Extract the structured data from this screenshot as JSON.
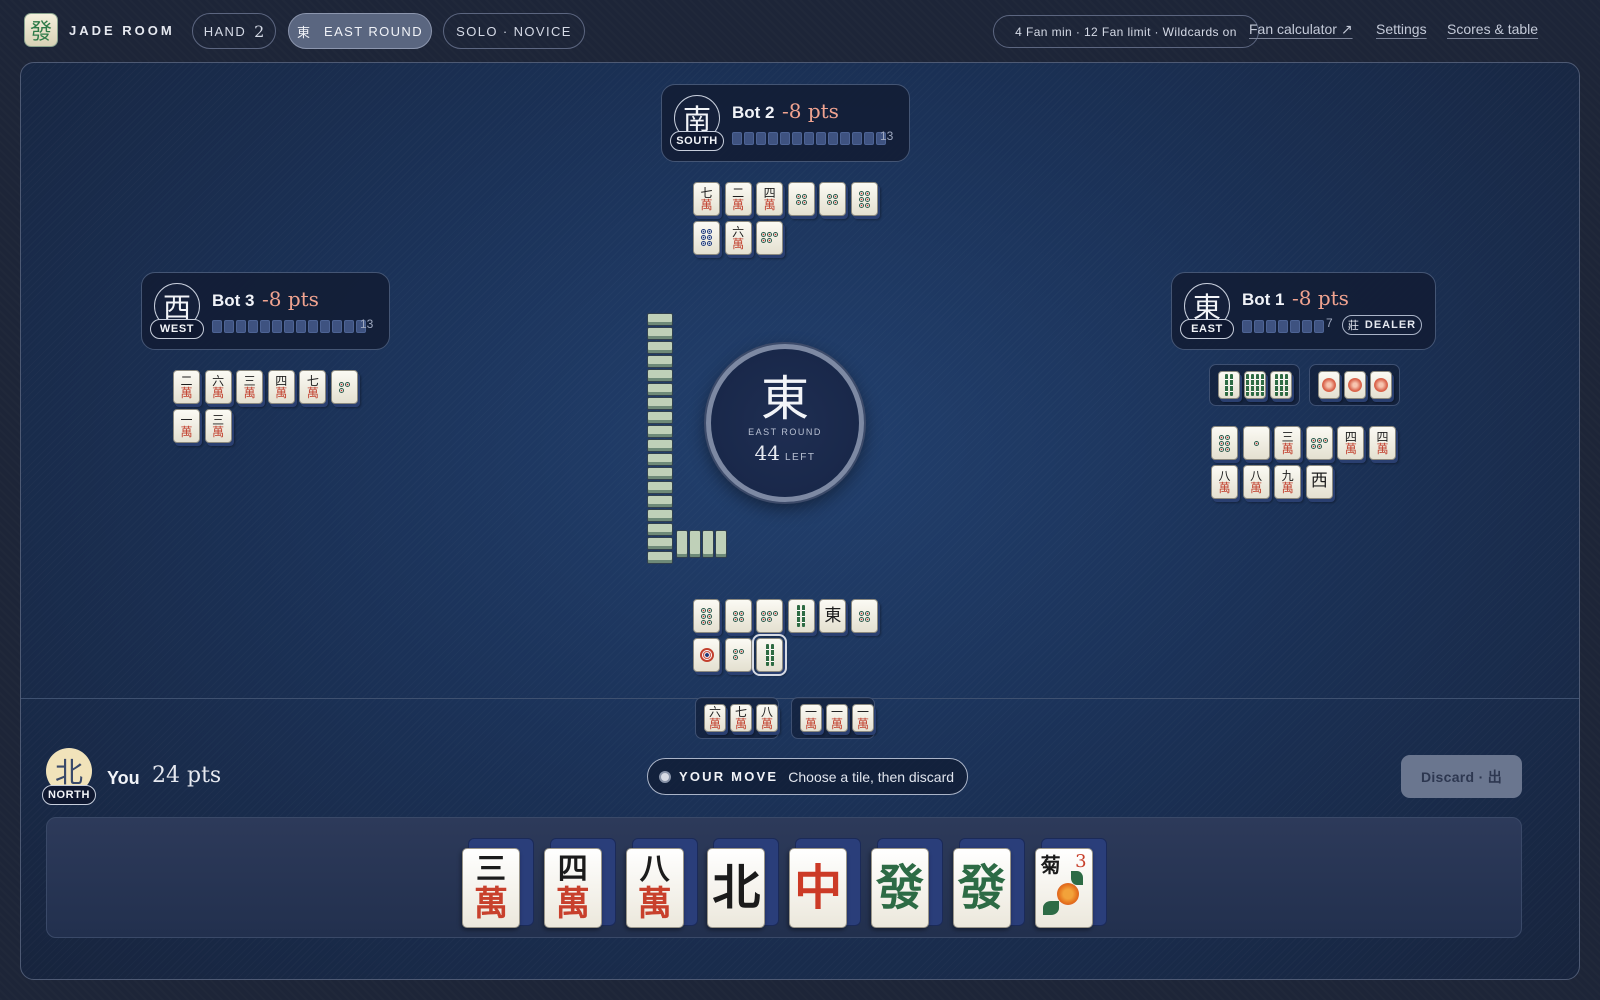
{
  "topbar": {
    "logo_glyph": "發",
    "brand": "JADE ROOM",
    "hand_label": "HAND",
    "hand_number": "2",
    "round_glyph": "東",
    "round_label": "EAST ROUND",
    "mode_label": "SOLO · NOVICE",
    "rules": "4 Fan min · 12 Fan limit · Wildcards on",
    "links": {
      "fan_calculator": "Fan calculator ↗",
      "settings": "Settings",
      "scores": "Scores & table"
    }
  },
  "players": {
    "south": {
      "seat_glyph": "南",
      "seat_label": "SOUTH",
      "name": "Bot 2",
      "points": "-8 pts",
      "tiles_in_hand": 13,
      "tiles_count_label": "13"
    },
    "west": {
      "seat_glyph": "西",
      "seat_label": "WEST",
      "name": "Bot 3",
      "points": "-8 pts",
      "tiles_in_hand": 13,
      "tiles_count_label": "13"
    },
    "east": {
      "seat_glyph": "東",
      "seat_label": "EAST",
      "name": "Bot 1",
      "points": "-8 pts",
      "tiles_in_hand": 7,
      "tiles_count_label": "7",
      "dealer_glyph": "莊",
      "dealer_label": "DEALER"
    }
  },
  "center": {
    "wind": "東",
    "round_label": "EAST ROUND",
    "tiles_left": "44",
    "left_label": "LEFT"
  },
  "discards": {
    "south": [
      {
        "t": "七",
        "b": "萬"
      },
      {
        "t": "二",
        "b": "萬"
      },
      {
        "t": "四",
        "b": "萬"
      },
      {
        "dots": 4
      },
      {
        "dots": 4
      },
      {
        "dots": 6
      },
      {
        "dots": 6,
        "color": "blue"
      },
      {
        "t": "六",
        "b": "萬"
      },
      {
        "dots": 5
      }
    ],
    "west": [
      {
        "t": "二",
        "b": "萬"
      },
      {
        "t": "六",
        "b": "萬"
      },
      {
        "t": "三",
        "b": "萬"
      },
      {
        "t": "四",
        "b": "萬"
      },
      {
        "t": "七",
        "b": "萬"
      },
      {
        "dots": 3
      },
      {
        "t": "一",
        "b": "萬"
      },
      {
        "t": "三",
        "b": "萬"
      }
    ],
    "east": [
      {
        "dots": 6
      },
      {
        "dots": 1
      },
      {
        "t": "三",
        "b": "萬"
      },
      {
        "dots": 5
      },
      {
        "t": "四",
        "b": "萬"
      },
      {
        "t": "四",
        "b": "萬"
      },
      {
        "t": "八",
        "b": "萬"
      },
      {
        "t": "八",
        "b": "萬"
      },
      {
        "t": "九",
        "b": "萬"
      },
      {
        "honor": "西"
      }
    ],
    "north": [
      {
        "dots": 6
      },
      {
        "dots": 4
      },
      {
        "dots": 5
      },
      {
        "sticks": 2
      },
      {
        "honor": "東"
      },
      {
        "dots": 4
      },
      {
        "dots": 1,
        "big": true
      },
      {
        "dots": 3
      },
      {
        "sticks": 2,
        "selected": true
      }
    ]
  },
  "melds": {
    "east": [
      [
        {
          "sticks": 2
        },
        {
          "sticks": 4
        },
        {
          "sticks": 3
        }
      ],
      [
        {
          "flower": "red"
        },
        {
          "flower": "red"
        },
        {
          "flower": "red"
        }
      ]
    ],
    "north": [
      [
        {
          "t": "六",
          "b": "萬"
        },
        {
          "t": "七",
          "b": "萬"
        },
        {
          "t": "八",
          "b": "萬"
        }
      ],
      [
        {
          "t": "一",
          "b": "萬"
        },
        {
          "t": "一",
          "b": "萬"
        },
        {
          "t": "一",
          "b": "萬"
        }
      ]
    ]
  },
  "you": {
    "seat_glyph": "北",
    "seat_label": "NORTH",
    "name": "You",
    "points": "24 pts",
    "move_label": "YOUR MOVE",
    "move_hint": "Choose a tile, then discard",
    "discard_label": "Discard · 出",
    "hand": [
      {
        "kind": "suit",
        "top": "三",
        "bottom": "萬"
      },
      {
        "kind": "suit",
        "top": "四",
        "bottom": "萬"
      },
      {
        "kind": "suit",
        "top": "八",
        "bottom": "萬"
      },
      {
        "kind": "honor",
        "glyph": "北",
        "color": "black"
      },
      {
        "kind": "honor",
        "glyph": "中",
        "color": "red"
      },
      {
        "kind": "honor",
        "glyph": "發",
        "color": "green"
      },
      {
        "kind": "honor",
        "glyph": "發",
        "color": "green"
      },
      {
        "kind": "flower",
        "glyph": "菊",
        "number": "3"
      }
    ]
  },
  "colors": {
    "accent": "#f0a390",
    "table": "#1b3258",
    "tray": "#2d3a5a",
    "tile_back": "#2a3e7a"
  },
  "wall": {
    "vertical_stack": 18,
    "horizontal_stack": 4
  }
}
